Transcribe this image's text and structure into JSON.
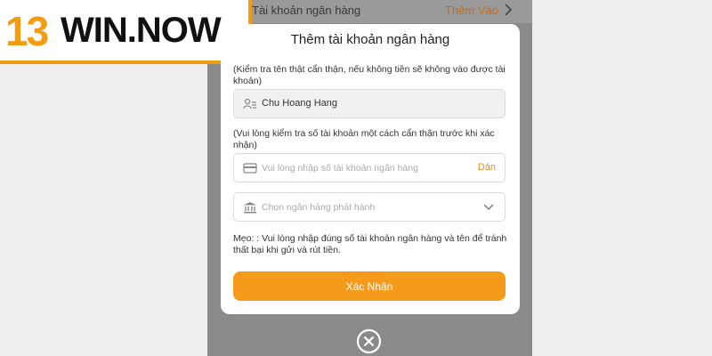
{
  "logo": {
    "number": "13",
    "word": "WIN.NOW"
  },
  "top_row": {
    "label": "Tài khoản ngân hàng",
    "action": "Thêm Vào"
  },
  "modal": {
    "title": "Thêm tài khoản ngân hàng",
    "name_note": "(Kiểm tra tên thật cẩn thận, nếu không tiền sẽ không vào được tài khoản)",
    "name_value": "Chu Hoang Hang",
    "account_note": "(Vui lòng kiểm tra số tài khoản một cách cẩn thận trước khi xác nhận)",
    "account_placeholder": "Vui lòng nhập số tài khoản ngân hàng",
    "paste_label": "Dán",
    "bank_placeholder": "Chọn ngân hàng phát hành",
    "tip": "Mẹo: :  Vui lòng nhập đúng số tài khoản ngân hàng và tên để tránh thất bại khi gửi và rút tiền.",
    "confirm_label": "Xác Nhận"
  },
  "colors": {
    "accent": "#f59a1b",
    "logo_orange": "#f39c12",
    "paste": "#e68a1c"
  },
  "icons": [
    "chevron-right-icon",
    "id-card-icon",
    "credit-card-icon",
    "bank-icon",
    "chevron-down-icon",
    "close-circle-icon"
  ]
}
